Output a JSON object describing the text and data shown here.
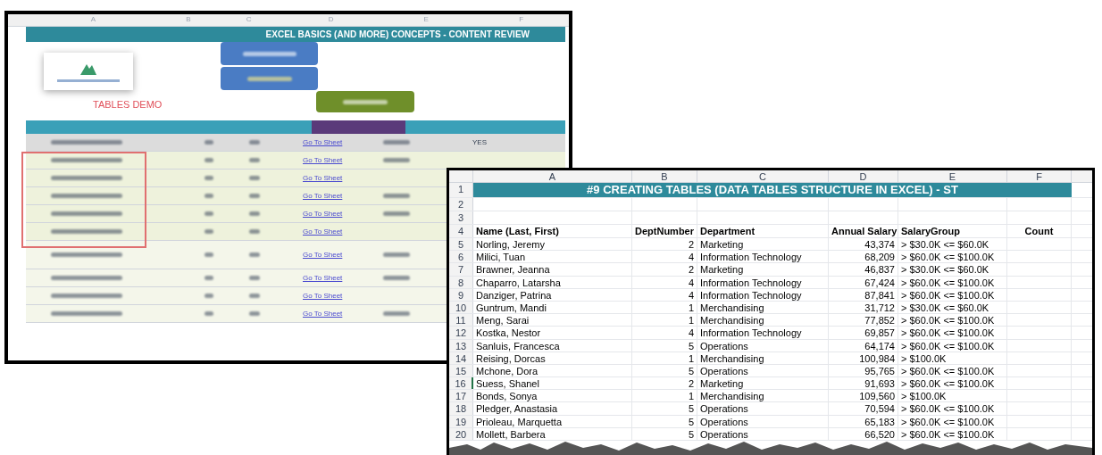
{
  "back_sheet": {
    "column_headers": [
      "A",
      "B",
      "C",
      "D",
      "E",
      "F"
    ],
    "title": "EXCEL BASICS (AND MORE) CONCEPTS - CONTENT REVIEW",
    "demo_label": "TABLES DEMO",
    "rows": [
      {
        "link": "Go To Sheet",
        "status": "YES",
        "highlighted": false
      },
      {
        "link": "Go To Sheet",
        "highlighted": true
      },
      {
        "link": "Go To Sheet",
        "highlighted": true
      },
      {
        "link": "Go To Sheet",
        "highlighted": true
      },
      {
        "link": "Go To Sheet",
        "highlighted": true
      },
      {
        "link": "Go To Sheet",
        "highlighted": true
      },
      {
        "link": "Go To Sheet",
        "highlighted": false
      },
      {
        "link": "Go To Sheet",
        "highlighted": false
      },
      {
        "link": "Go To Sheet",
        "highlighted": false
      },
      {
        "link": "Go To Sheet",
        "highlighted": false
      }
    ]
  },
  "front_sheet": {
    "column_headers": [
      "A",
      "B",
      "C",
      "D",
      "E",
      "F"
    ],
    "title": "#9 CREATING TABLES (DATA TABLES STRUCTURE IN EXCEL) - ST",
    "row_numbers": [
      "1",
      "2",
      "3",
      "4"
    ],
    "table": {
      "columns": [
        "Name (Last, First)",
        "DeptNumber",
        "Department",
        "Annual Salary",
        "SalaryGroup",
        "Count"
      ],
      "rows": [
        {
          "number": "5",
          "active": false,
          "cells": [
            "Norling, Jeremy",
            "2",
            "Marketing",
            "43,374",
            "> $30.0K <= $60.0K"
          ]
        },
        {
          "number": "6",
          "active": false,
          "cells": [
            "Milici, Tuan",
            "4",
            "Information Technology",
            "68,209",
            "> $60.0K <= $100.0K"
          ]
        },
        {
          "number": "7",
          "active": false,
          "cells": [
            "Brawner, Jeanna",
            "2",
            "Marketing",
            "46,837",
            "> $30.0K <= $60.0K"
          ]
        },
        {
          "number": "8",
          "active": false,
          "cells": [
            "Chaparro, Latarsha",
            "4",
            "Information Technology",
            "67,424",
            "> $60.0K <= $100.0K"
          ]
        },
        {
          "number": "9",
          "active": false,
          "cells": [
            "Danziger, Patrina",
            "4",
            "Information Technology",
            "87,841",
            "> $60.0K <= $100.0K"
          ]
        },
        {
          "number": "10",
          "active": false,
          "cells": [
            "Guntrum, Mandi",
            "1",
            "Merchandising",
            "31,712",
            "> $30.0K <= $60.0K"
          ]
        },
        {
          "number": "11",
          "active": false,
          "cells": [
            "Meng, Sarai",
            "1",
            "Merchandising",
            "77,852",
            "> $60.0K <= $100.0K"
          ]
        },
        {
          "number": "12",
          "active": false,
          "cells": [
            "Kostka, Nestor",
            "4",
            "Information Technology",
            "69,857",
            "> $60.0K <= $100.0K"
          ]
        },
        {
          "number": "13",
          "active": false,
          "cells": [
            "Sanluis, Francesca",
            "5",
            "Operations",
            "64,174",
            "> $60.0K <= $100.0K"
          ]
        },
        {
          "number": "14",
          "active": false,
          "cells": [
            "Reising, Dorcas",
            "1",
            "Merchandising",
            "100,984",
            "> $100.0K"
          ]
        },
        {
          "number": "15",
          "active": false,
          "cells": [
            "Mchone, Dora",
            "5",
            "Operations",
            "95,765",
            "> $60.0K <= $100.0K"
          ]
        },
        {
          "number": "16",
          "active": true,
          "cells": [
            "Suess, Shanel",
            "2",
            "Marketing",
            "91,693",
            "> $60.0K <= $100.0K"
          ]
        },
        {
          "number": "17",
          "active": false,
          "cells": [
            "Bonds, Sonya",
            "1",
            "Merchandising",
            "109,560",
            "> $100.0K"
          ]
        },
        {
          "number": "18",
          "active": false,
          "cells": [
            "Pledger, Anastasia",
            "5",
            "Operations",
            "70,594",
            "> $60.0K <= $100.0K"
          ]
        },
        {
          "number": "19",
          "active": false,
          "cells": [
            "Prioleau, Marquetta",
            "5",
            "Operations",
            "65,183",
            "> $60.0K <= $100.0K"
          ]
        },
        {
          "number": "20",
          "active": false,
          "cells": [
            "Mollett, Barbera",
            "5",
            "Operations",
            "66,520",
            "> $60.0K <= $100.0K"
          ]
        }
      ]
    }
  }
}
